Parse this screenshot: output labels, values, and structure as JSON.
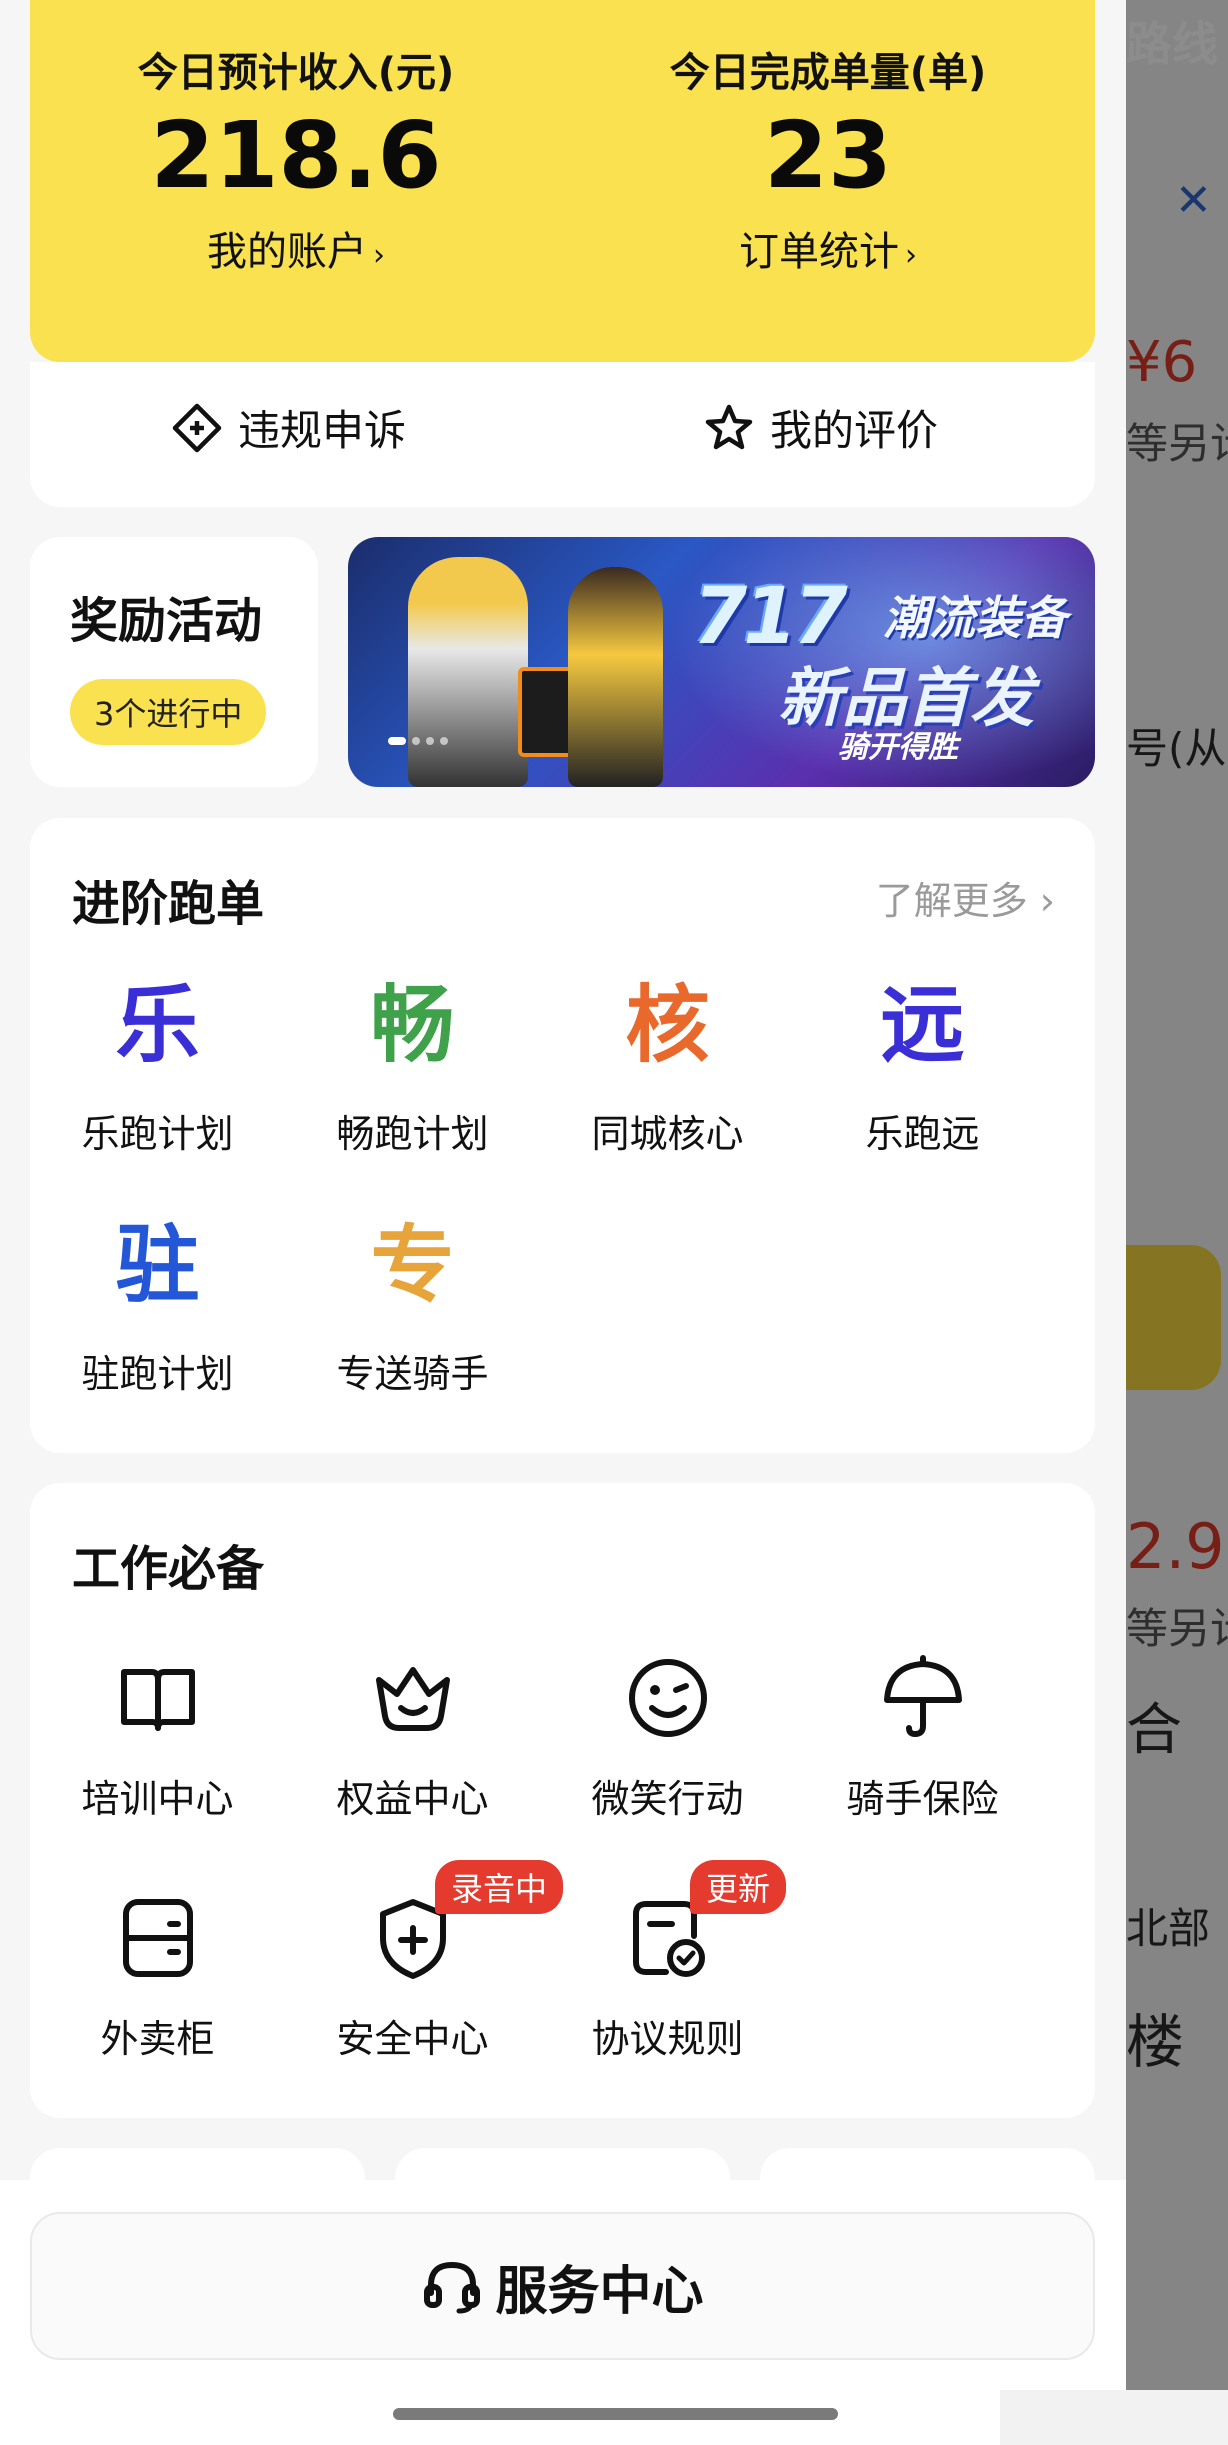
{
  "background": {
    "route_label": "路线",
    "lines": [
      "¥6",
      "等另计",
      "号(从",
      "2.9",
      "等另计",
      "合",
      "北部",
      "楼"
    ]
  },
  "stats": {
    "income": {
      "title": "今日预计收入(元)",
      "value": "218.6",
      "link": "我的账户"
    },
    "orders": {
      "title": "今日完成单量(单)",
      "value": "23",
      "link": "订单统计"
    }
  },
  "quick_actions": {
    "appeal": "违规申诉",
    "rating": "我的评价"
  },
  "reward": {
    "title": "奖励活动",
    "badge": "3个进行中"
  },
  "banner": {
    "headline": "717",
    "line1": "潮流装备",
    "line2": "新品首发",
    "line3": "骑开得胜"
  },
  "advanced": {
    "title": "进阶跑单",
    "more": "了解更多",
    "items": [
      {
        "glyph": "乐",
        "label": "乐跑计划",
        "color": "#3a2fd6"
      },
      {
        "glyph": "畅",
        "label": "畅跑计划",
        "color": "#3fa14a"
      },
      {
        "glyph": "核",
        "label": "同城核心",
        "color": "#e8692b"
      },
      {
        "glyph": "远",
        "label": "乐跑远",
        "color": "#3a2fd6"
      },
      {
        "glyph": "驻",
        "label": "驻跑计划",
        "color": "#2456d8"
      },
      {
        "glyph": "专",
        "label": "专送骑手",
        "color": "#e6a43a"
      }
    ]
  },
  "essentials": {
    "title": "工作必备",
    "items": [
      {
        "icon": "book-icon",
        "label": "培训中心"
      },
      {
        "icon": "crown-icon",
        "label": "权益中心"
      },
      {
        "icon": "smile-icon",
        "label": "微笑行动"
      },
      {
        "icon": "umbrella-icon",
        "label": "骑手保险"
      },
      {
        "icon": "locker-icon",
        "label": "外卖柜"
      },
      {
        "icon": "shield-plus-icon",
        "label": "安全中心",
        "tag": "录音中"
      },
      {
        "icon": "document-check-icon",
        "label": "协议规则",
        "tag": "更新"
      }
    ]
  },
  "service_center": {
    "label": "服务中心"
  }
}
